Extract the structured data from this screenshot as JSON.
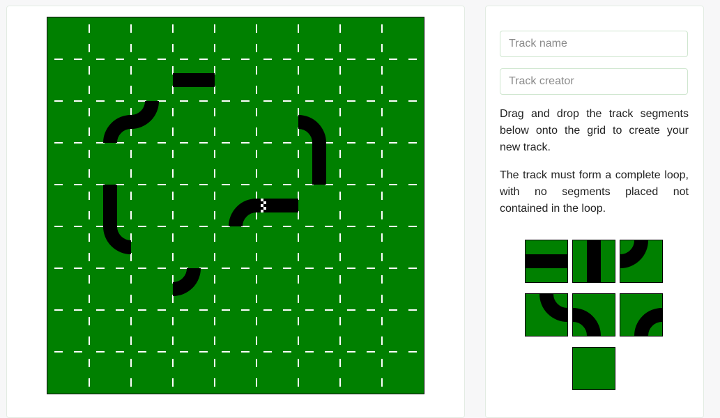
{
  "form": {
    "track_name_placeholder": "Track name",
    "track_creator_placeholder": "Track creator"
  },
  "instructions": {
    "drag_drop": "Drag and drop the track segments below onto the grid to create your new track.",
    "loop_rule": "The track must form a complete loop, with no segments placed not contained in the loop."
  },
  "colors": {
    "grass": "#008000",
    "track": "#000000",
    "grid_mark": "#ffffff"
  },
  "grid": {
    "columns": 9,
    "rows": 9,
    "placed_segments": [
      {
        "col": 3,
        "row": 1,
        "type": "straight-horizontal"
      },
      {
        "col": 2,
        "row": 2,
        "type": "curve-left-top"
      },
      {
        "col": 1,
        "row": 2,
        "type": "curve-right-bottom"
      },
      {
        "col": 6,
        "row": 2,
        "type": "curve-left-bottom"
      },
      {
        "col": 6,
        "row": 3,
        "type": "straight-vertical"
      },
      {
        "col": 1,
        "row": 4,
        "type": "straight-vertical"
      },
      {
        "col": 1,
        "row": 5,
        "type": "curve-top-right"
      },
      {
        "col": 4,
        "row": 4,
        "type": "curve-right-bottom"
      },
      {
        "col": 5,
        "row": 4,
        "type": "straight-horizontal",
        "start_marker": true
      },
      {
        "col": 3,
        "row": 6,
        "type": "curve-left-top"
      }
    ]
  },
  "palette": [
    {
      "type": "straight-horizontal",
      "icon": "straight-horizontal-track-icon"
    },
    {
      "type": "straight-vertical",
      "icon": "straight-vertical-track-icon"
    },
    {
      "type": "curve-left-top",
      "icon": "curve-left-top-track-icon"
    },
    {
      "type": "curve-top-right",
      "icon": "curve-top-right-track-icon"
    },
    {
      "type": "curve-left-bottom",
      "icon": "curve-left-bottom-track-icon"
    },
    {
      "type": "curve-right-bottom",
      "icon": "curve-right-bottom-track-icon"
    },
    {
      "type": "empty",
      "icon": "empty-tile-icon"
    }
  ]
}
